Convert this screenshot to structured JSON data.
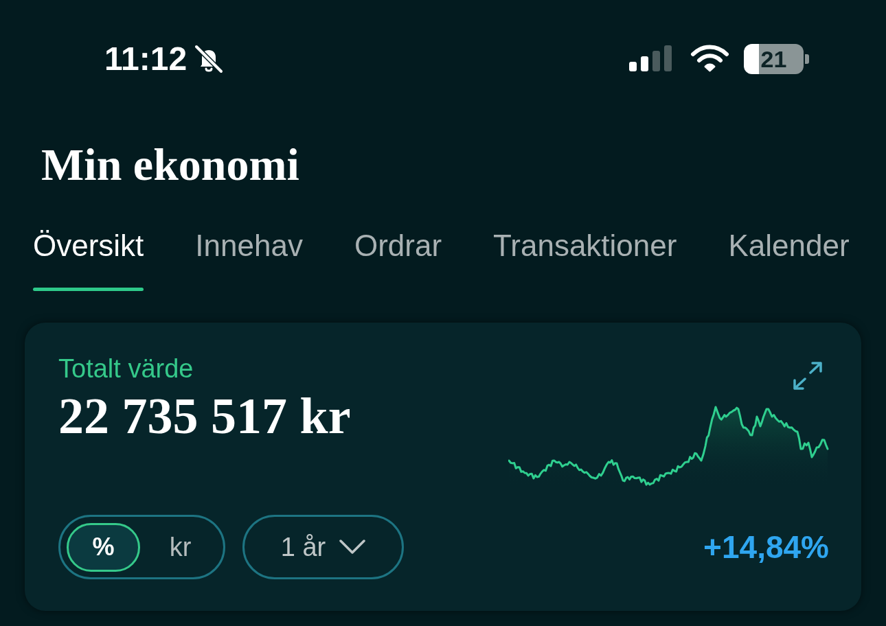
{
  "status_bar": {
    "time": "11:12",
    "battery": "21"
  },
  "title": "Min ekonomi",
  "tabs": [
    {
      "label": "Översikt",
      "selected": true
    },
    {
      "label": "Innehav",
      "selected": false
    },
    {
      "label": "Ordrar",
      "selected": false
    },
    {
      "label": "Transaktioner",
      "selected": false
    },
    {
      "label": "Kalender",
      "selected": false
    }
  ],
  "summary_card": {
    "label": "Totalt värde",
    "value": "22 735 517 kr",
    "unit_toggle": [
      {
        "label": "%",
        "selected": true
      },
      {
        "label": "kr",
        "selected": false
      }
    ],
    "period": "1 år",
    "change": "+14,84%"
  }
}
